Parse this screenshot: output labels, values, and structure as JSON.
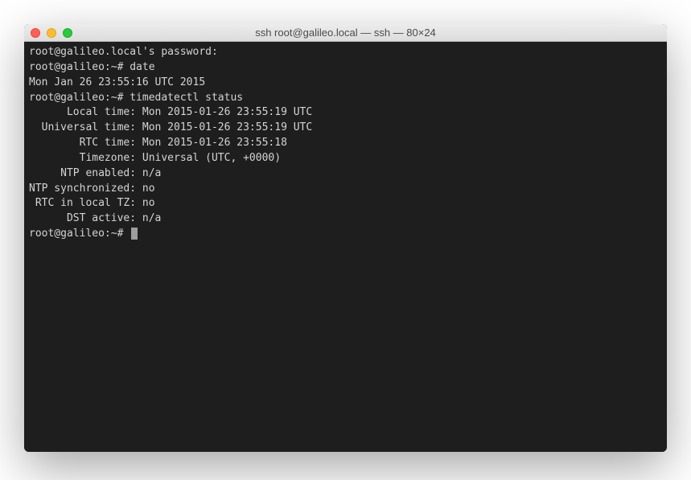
{
  "window": {
    "title": "ssh root@galileo.local — ssh — 80×24"
  },
  "terminal": {
    "lines": [
      "root@galileo.local's password:",
      "root@galileo:~# date",
      "Mon Jan 26 23:55:16 UTC 2015",
      "root@galileo:~# timedatectl status",
      "      Local time: Mon 2015-01-26 23:55:19 UTC",
      "  Universal time: Mon 2015-01-26 23:55:19 UTC",
      "        RTC time: Mon 2015-01-26 23:55:18",
      "        Timezone: Universal (UTC, +0000)",
      "     NTP enabled: n/a",
      "NTP synchronized: no",
      " RTC in local TZ: no",
      "      DST active: n/a"
    ],
    "prompt": "root@galileo:~# "
  }
}
